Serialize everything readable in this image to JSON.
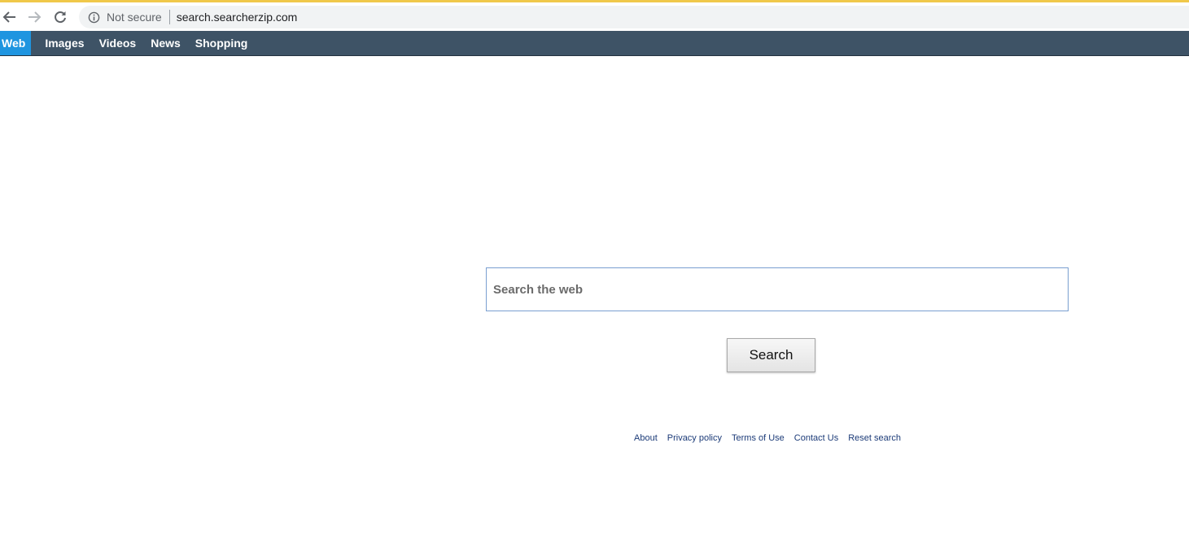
{
  "browser": {
    "security_label": "Not secure",
    "url": "search.searcherzip.com",
    "icons": {
      "back": "back-arrow-icon",
      "forward": "forward-arrow-icon",
      "reload": "reload-icon",
      "info": "info-icon"
    }
  },
  "nav": {
    "tabs": [
      {
        "label": "Web",
        "active": true
      },
      {
        "label": "Images",
        "active": false
      },
      {
        "label": "Videos",
        "active": false
      },
      {
        "label": "News",
        "active": false
      },
      {
        "label": "Shopping",
        "active": false
      }
    ]
  },
  "search": {
    "placeholder": "Search the web",
    "value": "",
    "button_label": "Search"
  },
  "footer": {
    "links": [
      "About",
      "Privacy policy",
      "Terms of Use",
      "Contact Us",
      "Reset search"
    ]
  },
  "colors": {
    "nav_bg": "#3e5366",
    "nav_active": "#1f95e0",
    "footer_link": "#1c3b78",
    "input_border": "#7a9fd0"
  }
}
